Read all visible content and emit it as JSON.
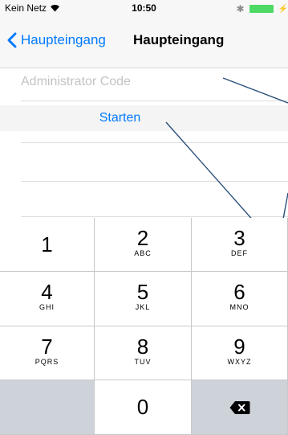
{
  "status_bar": {
    "carrier": "Kein Netz",
    "time": "10:50"
  },
  "nav": {
    "back_label": "Haupteingang",
    "title": "Haupteingang"
  },
  "form": {
    "code_placeholder": "Administrator Code",
    "code_value": "",
    "start_label": "Starten"
  },
  "keypad": [
    {
      "num": "1",
      "letters": ""
    },
    {
      "num": "2",
      "letters": "ABC"
    },
    {
      "num": "3",
      "letters": "DEF"
    },
    {
      "num": "4",
      "letters": "GHI"
    },
    {
      "num": "5",
      "letters": "JKL"
    },
    {
      "num": "6",
      "letters": "MNO"
    },
    {
      "num": "7",
      "letters": "PQRS"
    },
    {
      "num": "8",
      "letters": "TUV"
    },
    {
      "num": "9",
      "letters": "WXYZ"
    },
    {
      "num": "",
      "letters": ""
    },
    {
      "num": "0",
      "letters": ""
    },
    {
      "icon": "delete-icon"
    }
  ],
  "colors": {
    "accent": "#007aff",
    "battery": "#4cd964",
    "annotation_line": "#2b4f7a"
  }
}
